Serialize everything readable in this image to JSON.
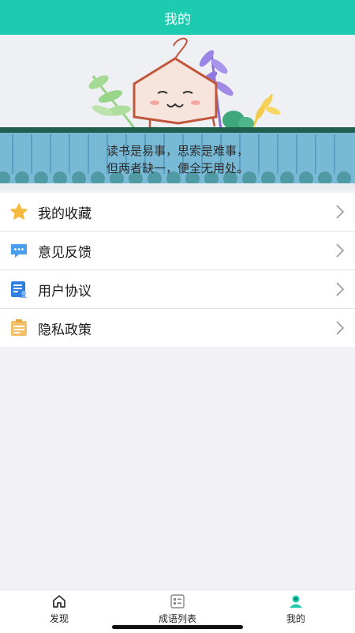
{
  "header": {
    "title": "我的"
  },
  "hero": {
    "quote_line1": "读书是易事，思索是难事，",
    "quote_line2": "但两者缺一，便全无用处。"
  },
  "menu": {
    "items": [
      {
        "label": "我的收藏",
        "icon": "star-icon"
      },
      {
        "label": "意见反馈",
        "icon": "feedback-icon"
      },
      {
        "label": "用户协议",
        "icon": "user-agreement-icon"
      },
      {
        "label": "隐私政策",
        "icon": "privacy-policy-icon"
      }
    ]
  },
  "tabbar": {
    "tabs": [
      {
        "label": "发现",
        "icon": "home-icon"
      },
      {
        "label": "成语列表",
        "icon": "list-icon"
      },
      {
        "label": "我的",
        "icon": "profile-icon",
        "active": true
      }
    ]
  },
  "colors": {
    "accent": "#1ccbb0",
    "star": "#f5b93e",
    "feedback": "#4a9eee",
    "agreement": "#2e7fe0",
    "policy": "#f3c069"
  }
}
